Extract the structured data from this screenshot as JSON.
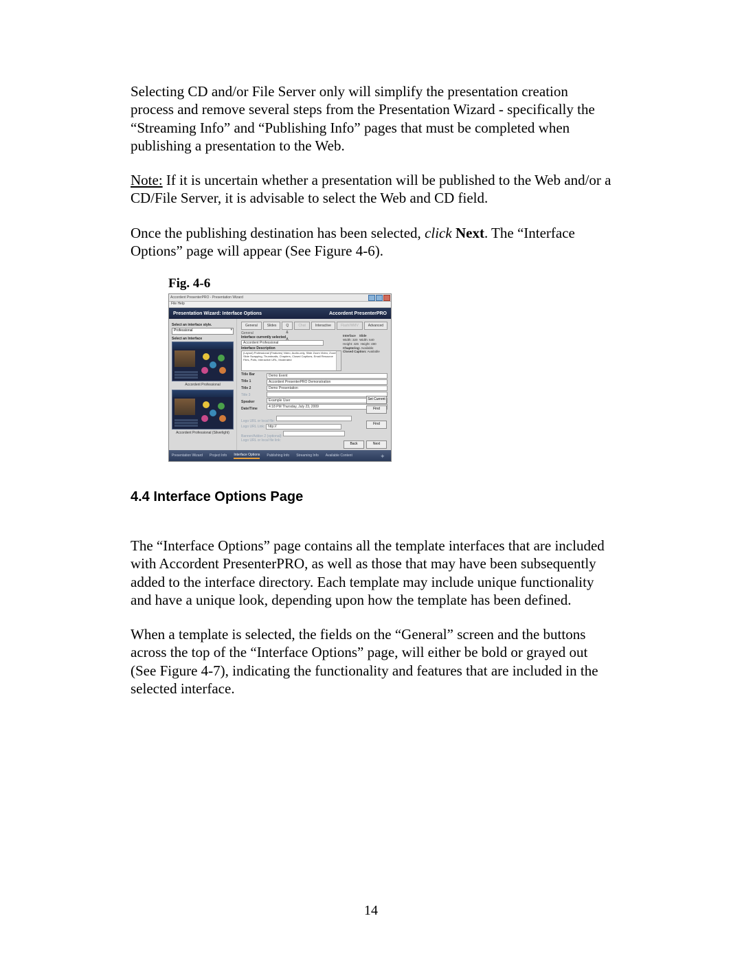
{
  "para1": "Selecting CD and/or File Server only will simplify the presentation creation process and remove several steps from the Presentation Wizard - specifically the “Streaming Info” and “Publishing Info” pages that must be completed when publishing a presentation to the Web.",
  "para2_note": "Note:",
  "para2_rest": " If it is uncertain whether a presentation will be published to the Web and/or a CD/File Server, it is advisable to select the Web and CD field.",
  "para3_a": "Once the publishing destination has been selected, ",
  "para3_click": "click",
  "para3_space": " ",
  "para3_next": "Next",
  "para3_b": ".  The “Interface Options” page will appear (See Figure 4-6).",
  "fig_label": "Fig. 4-6",
  "section_heading": "4.4  Interface Options Page",
  "para4": "The “Interface Options” page contains all the template interfaces that are included with Accordent PresenterPRO, as well as those that may have been subsequently added to the interface directory.  Each template may include unique functionality and have a unique look, depending upon how the template has been defined.",
  "para5": "When a template is selected, the fields on the “General” screen and the buttons across the top of the “Interface Options” page, will either be bold or grayed out (See Figure 4-7),  indicating the functionality and features that are included in the selected interface.",
  "page_number": "14",
  "shot": {
    "window_title": "Accordent PresenterPRO - Presentation Wizard",
    "menu": "File   Help",
    "blue_title": "Presentation Wizard: Interface Options",
    "brand_a": "Accordent ",
    "brand_b": "PresenterPRO",
    "left": {
      "style_label": "Select an interface style.",
      "style_value": "Professional",
      "interface_label": "Select an Interface",
      "thumb1_caption": "Accordent Professional",
      "thumb2_caption": "Accordent Professional (Silverlight)"
    },
    "tabs": [
      "General",
      "Slides",
      "Q & A",
      "Chat",
      "Interactive",
      "Flash/WMV",
      "Advanced"
    ],
    "tabs_disabled": [
      3,
      5
    ],
    "general": {
      "group": "General",
      "cur_sel_label": "Interface currently selected",
      "cur_sel_value": "Accordent Professional",
      "desc_label": "Interface Description",
      "desc_value": "(Layout)\nProfessional\n\n(Features)\nVideo, Audio-only, Slide Zoom Video, Zoom Slide Swapping, Thumbnails, Chapters, Closed Captions, Email Resource Files, Polls, Interactive URL, Moderated",
      "titlebar_label": "Title Bar",
      "titlebar_value": "Demo Event",
      "title1_label": "Title 1",
      "title1_value": "Accordent PresenterPRO Demonstration",
      "title2_label": "Title 2",
      "title2_value": "Demo Presentation",
      "title3_label": "Title 3",
      "title3_value": "",
      "speaker_label": "Speaker",
      "speaker_value": "Example User",
      "datetime_label": "Date/Time",
      "datetime_value": "4:18 PM Thursday, July 23, 2009",
      "logo1_label": "Logo URL or local file:",
      "logo1_link_label": "Logo URL Link:",
      "logo1_link_value": "http://",
      "logo2_label": "Banner/Addon 2 (optional):",
      "logo2_link_label": "Logo URL or local file link:"
    },
    "meta": {
      "interface_h": "Interface",
      "slide_h": "Slide",
      "width_l": "Width:",
      "width_v": "320",
      "swidth_v": "640",
      "height_l": "Height:",
      "height_v": "426",
      "sheight_v": "480",
      "chap_l": "Chaptering:",
      "chap_v": "Available",
      "cc_l": "Closed Caption:",
      "cc_v": "Available"
    },
    "btns": {
      "setcurrent": "Set Current",
      "find1": "Find",
      "find2": "Find",
      "back": "Back",
      "next": "Next"
    },
    "bottom_steps": [
      "Presentation Wizard",
      "Project Info",
      "Interface Options",
      "Publishing Info",
      "Streaming Info",
      "Available Content"
    ]
  }
}
